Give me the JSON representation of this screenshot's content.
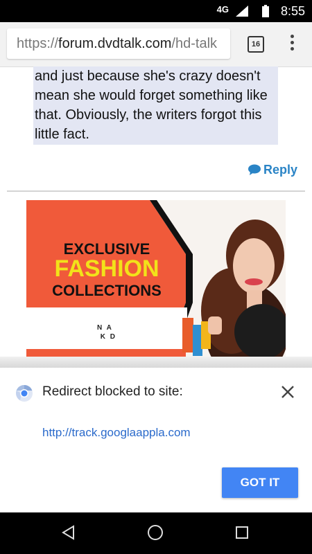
{
  "status_bar": {
    "network": "4G",
    "time": "8:55"
  },
  "browser": {
    "url_scheme": "https://",
    "url_host": "forum.dvdtalk.com",
    "url_path": "/hd-talk",
    "tab_count": "16"
  },
  "post": {
    "quote_text": "and just because she's crazy doesn't mean she would forget something like that. Obviously, the writers forgot this little fact.",
    "reply_label": "Reply"
  },
  "ad": {
    "line1": "EXCLUSIVE",
    "line2": "FASHION",
    "line3": "COLLECTIONS",
    "logo_text": "N A\n K D",
    "accent_color": "#f05a3a",
    "highlight_color": "#f2e21a"
  },
  "sheet": {
    "title": "Redirect blocked to site:",
    "link": "http://track.googlaappla.com",
    "button_label": "GOT IT",
    "button_color": "#4285f4"
  }
}
